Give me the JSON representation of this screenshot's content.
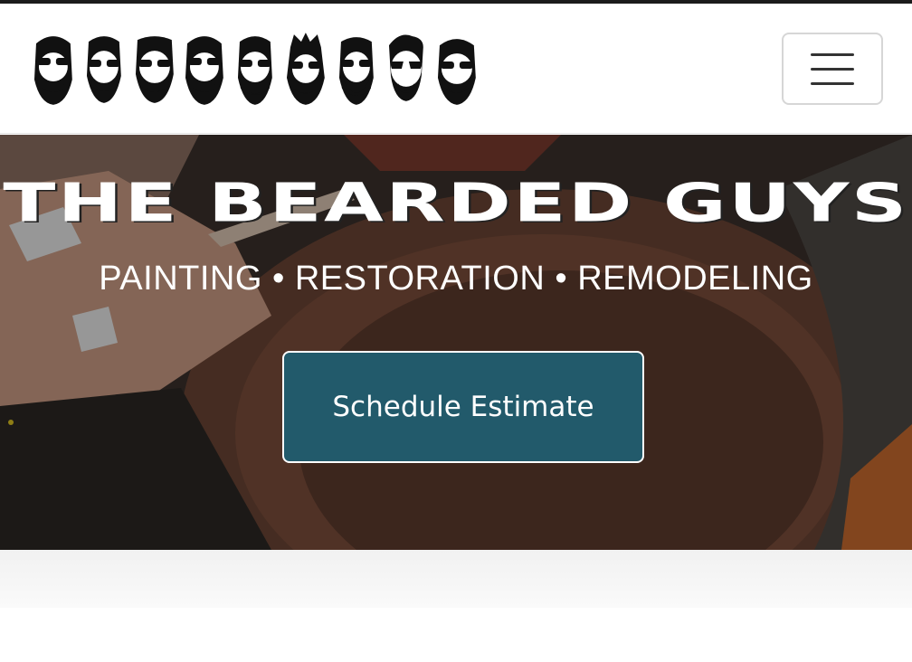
{
  "header": {
    "logo_faces": [
      "bearded-face-1",
      "bearded-face-2",
      "bearded-face-3",
      "bearded-face-4",
      "bearded-face-5",
      "bearded-face-6",
      "bearded-face-7",
      "bearded-face-8",
      "bearded-face-9"
    ],
    "menu_icon": "hamburger-menu-icon"
  },
  "hero": {
    "title": "THE BEARDED GUYS",
    "subtitle": "PAINTING • RESTORATION • REMODELING",
    "cta_label": "Schedule Estimate",
    "cta_color": "#225a6b"
  }
}
